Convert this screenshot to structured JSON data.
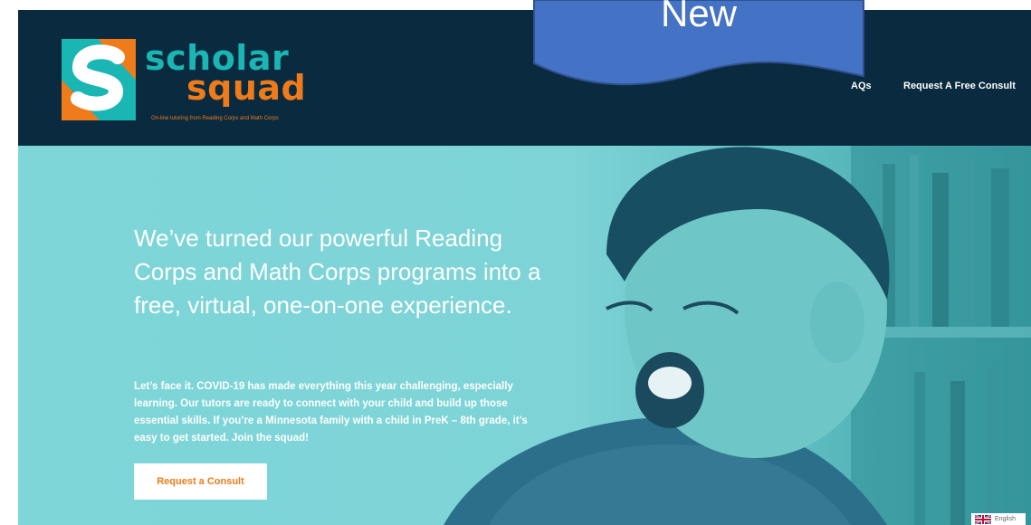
{
  "header": {
    "logo": {
      "word1": "scholar",
      "word2": "squad",
      "tagline": "On-line tutoring from Reading Corps and Math Corps"
    },
    "nav": [
      {
        "label": "AQs"
      },
      {
        "label": "Request A Free Consult"
      }
    ]
  },
  "hero": {
    "headline": "We’ve turned our powerful Reading Corps and Math Corps programs into a free, virtual, one-on-one experience.",
    "body": "Let’s face it. COVID-19 has made everything this year challenging, especially learning. Our tutors are ready to connect with your child and build up those essential skills. If you’re a Minnesota family with a child in PreK – 8th grade, it’s easy to get started. Join the squad!",
    "cta_label": "Request a Consult"
  },
  "language": {
    "label": "English",
    "icon": "uk-flag-icon"
  },
  "overlay": {
    "label": "New"
  },
  "colors": {
    "header_bg": "#0a2a3f",
    "teal": "#19b6b4",
    "orange": "#ef7b1a",
    "hero_bg": "#7fd6d9",
    "banner": "#4472c4"
  }
}
